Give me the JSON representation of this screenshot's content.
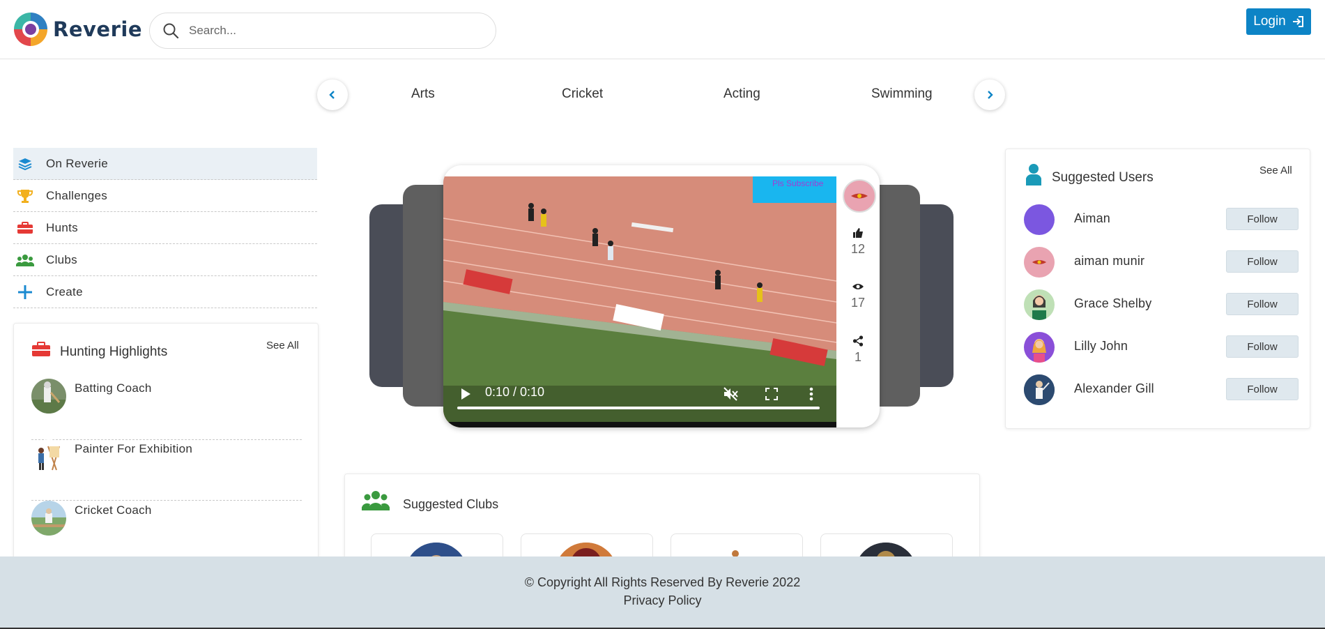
{
  "app": {
    "name": "Reverie"
  },
  "search": {
    "placeholder": "Search..."
  },
  "header": {
    "login_label": "Login"
  },
  "categories": [
    "Arts",
    "Cricket",
    "Acting",
    "Swimming"
  ],
  "sidebar": {
    "items": [
      {
        "label": "On Reverie",
        "icon": "layers-icon"
      },
      {
        "label": "Challenges",
        "icon": "trophy-icon"
      },
      {
        "label": "Hunts",
        "icon": "briefcase-icon"
      },
      {
        "label": "Clubs",
        "icon": "group-icon"
      },
      {
        "label": "Create",
        "icon": "plus-icon"
      }
    ]
  },
  "hunting": {
    "title": "Hunting Highlights",
    "see_all": "See All",
    "items": [
      {
        "title": "Batting Coach"
      },
      {
        "title": "Painter For Exhibition"
      },
      {
        "title": "Cricket Coach"
      }
    ]
  },
  "video": {
    "time": "0:10 / 0:10",
    "likes": "12",
    "views": "17",
    "shares": "1",
    "overlay_text": "Pls Subscribe"
  },
  "suggested_users": {
    "title": "Suggested Users",
    "see_all": "See All",
    "follow_label": "Follow",
    "users": [
      {
        "name": "Aiman",
        "avatar_color": "#7b57e0"
      },
      {
        "name": "aiman munir",
        "avatar_color": "#e9a3b1"
      },
      {
        "name": "Grace Shelby",
        "avatar_color": "#bfe0b6"
      },
      {
        "name": "Lilly John",
        "avatar_color": "#8a4fd8"
      },
      {
        "name": "Alexander Gill",
        "avatar_color": "#2c4a70"
      }
    ]
  },
  "suggested_clubs": {
    "title": "Suggested Clubs"
  },
  "footer": {
    "copyright": "© Copyright All Rights Reserved By Reverie 2022",
    "privacy": "Privacy Policy"
  },
  "colors": {
    "accent": "#0d84c6",
    "footer_bg": "#d6e0e6",
    "hunts_red": "#e53935",
    "clubs_green": "#3a9a3f"
  }
}
